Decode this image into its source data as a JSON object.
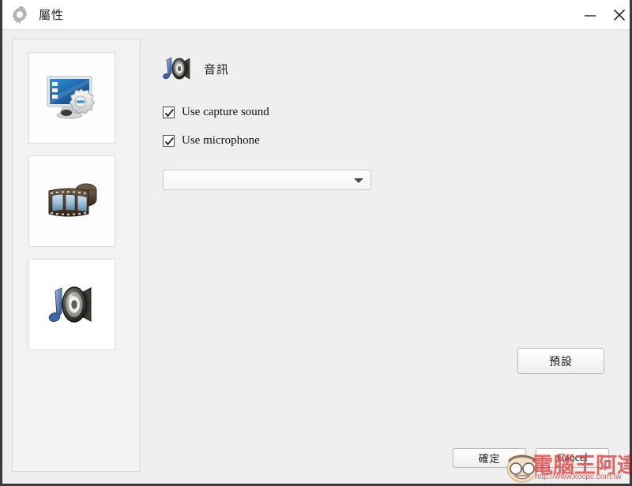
{
  "window": {
    "title": "屬性",
    "gear_icon": "gear-icon",
    "controls": [
      {
        "name": "minimize-button",
        "icon": "minimize-icon",
        "label": "—"
      },
      {
        "name": "close-button",
        "icon": "close-icon",
        "label": "✕"
      }
    ]
  },
  "sidebar": {
    "items": [
      {
        "name": "sidebar-item-general",
        "icon": "monitor-gear-icon",
        "selected": false
      },
      {
        "name": "sidebar-item-video",
        "icon": "film-strip-icon",
        "selected": false
      },
      {
        "name": "sidebar-item-audio",
        "icon": "speaker-music-note-icon",
        "selected": true
      }
    ]
  },
  "main": {
    "section_icon": "speaker-music-note-icon",
    "section_title": "音訊",
    "checkboxes": [
      {
        "label": "Use capture sound",
        "checked": true
      },
      {
        "label": "Use microphone",
        "checked": true
      }
    ],
    "device_select": {
      "value": "",
      "placeholder": "",
      "arrow_icon": "chevron-down-icon"
    },
    "buttons": {
      "default_label": "預設",
      "ok_label": "確定",
      "cancel_label": "Cancel"
    }
  },
  "watermark": {
    "text": "電腦王阿達",
    "url": "http://www.kocpc.com.tw",
    "face_icon": "face-logo-icon"
  },
  "colors": {
    "window_background": "#efefef",
    "titlebar_background": "#ffffff",
    "panel_background": "#f2f2f2",
    "tile_background": "#fdfdfd",
    "border": "#d9d9d9",
    "text": "#1d1d1d",
    "watermark_red": "#e63c3c"
  }
}
